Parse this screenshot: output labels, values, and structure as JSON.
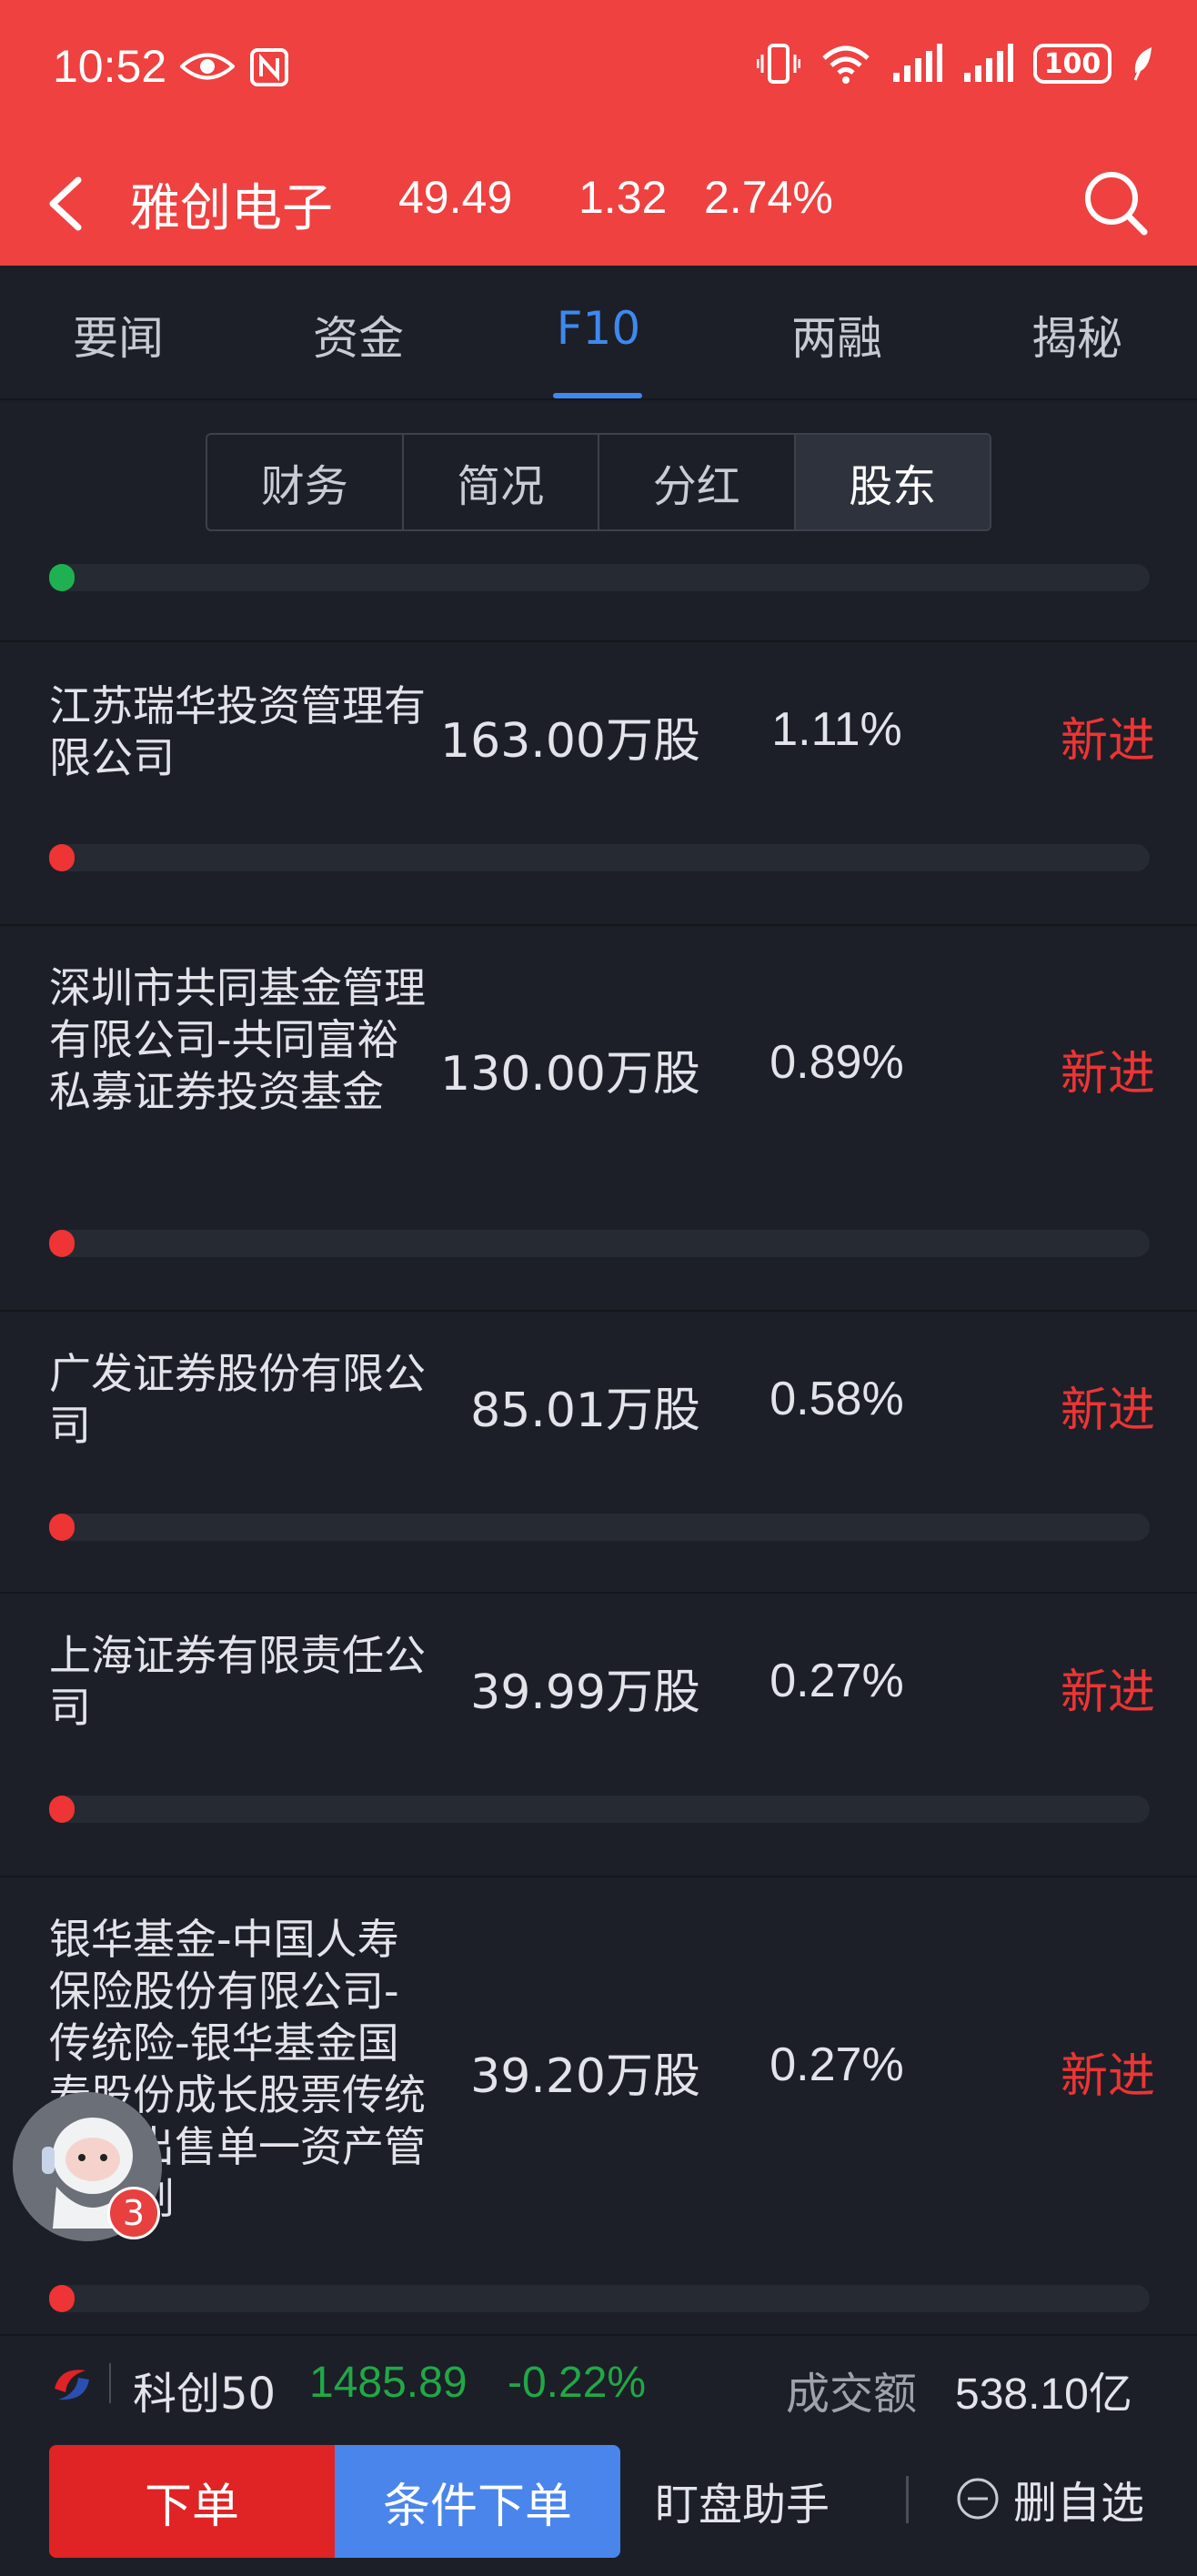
{
  "status_bar": {
    "time": "10:52",
    "battery": "100",
    "icons": [
      "eye-icon",
      "nfc-icon",
      "vibrate-icon",
      "wifi-icon",
      "signal-icon",
      "signal-icon-2",
      "battery-icon",
      "leaf-icon"
    ]
  },
  "header": {
    "stock_name": "雅创电子",
    "price": "49.49",
    "change": "1.32",
    "change_pct": "2.74%",
    "icons": [
      "back-arrow-icon",
      "search-icon"
    ],
    "color": "#ee4140"
  },
  "tabs": [
    "要闻",
    "资金",
    "F10",
    "两融",
    "揭秘"
  ],
  "active_tab": "F10",
  "segments": [
    "财务",
    "简况",
    "分红",
    "股东"
  ],
  "active_segment": "股东",
  "prev_row_bar_color": "#1fb151",
  "holders": [
    {
      "name": "江苏瑞华投资管理有限公司",
      "shares": "163.00万股",
      "ratio": "1.11%",
      "status": "新进"
    },
    {
      "name": "深圳市共同基金管理有限公司-共同富裕私募证券投资基金",
      "shares": "130.00万股",
      "ratio": "0.89%",
      "status": "新进"
    },
    {
      "name": "广发证券股份有限公司",
      "shares": "85.01万股",
      "ratio": "0.58%",
      "status": "新进"
    },
    {
      "name": "上海证券有限责任公司",
      "shares": "39.99万股",
      "ratio": "0.27%",
      "status": "新进"
    },
    {
      "name": "银华基金-中国人寿保险股份有限公司-传统险-银华基金国寿股份成长股票传统可供出售单一资产管理计划",
      "shares": "39.20万股",
      "ratio": "0.27%",
      "status": "新进"
    }
  ],
  "assistant": {
    "badge": "3"
  },
  "index_bar": {
    "name": "科创50",
    "value": "1485.89",
    "change_pct": "-0.22%",
    "turnover_label": "成交额",
    "turnover_value": "538.10亿",
    "down_color": "#21a846"
  },
  "actions": {
    "order": "下单",
    "conditional_order": "条件下单",
    "watch_assistant": "盯盘助手",
    "remove_watchlist": "删自选"
  }
}
